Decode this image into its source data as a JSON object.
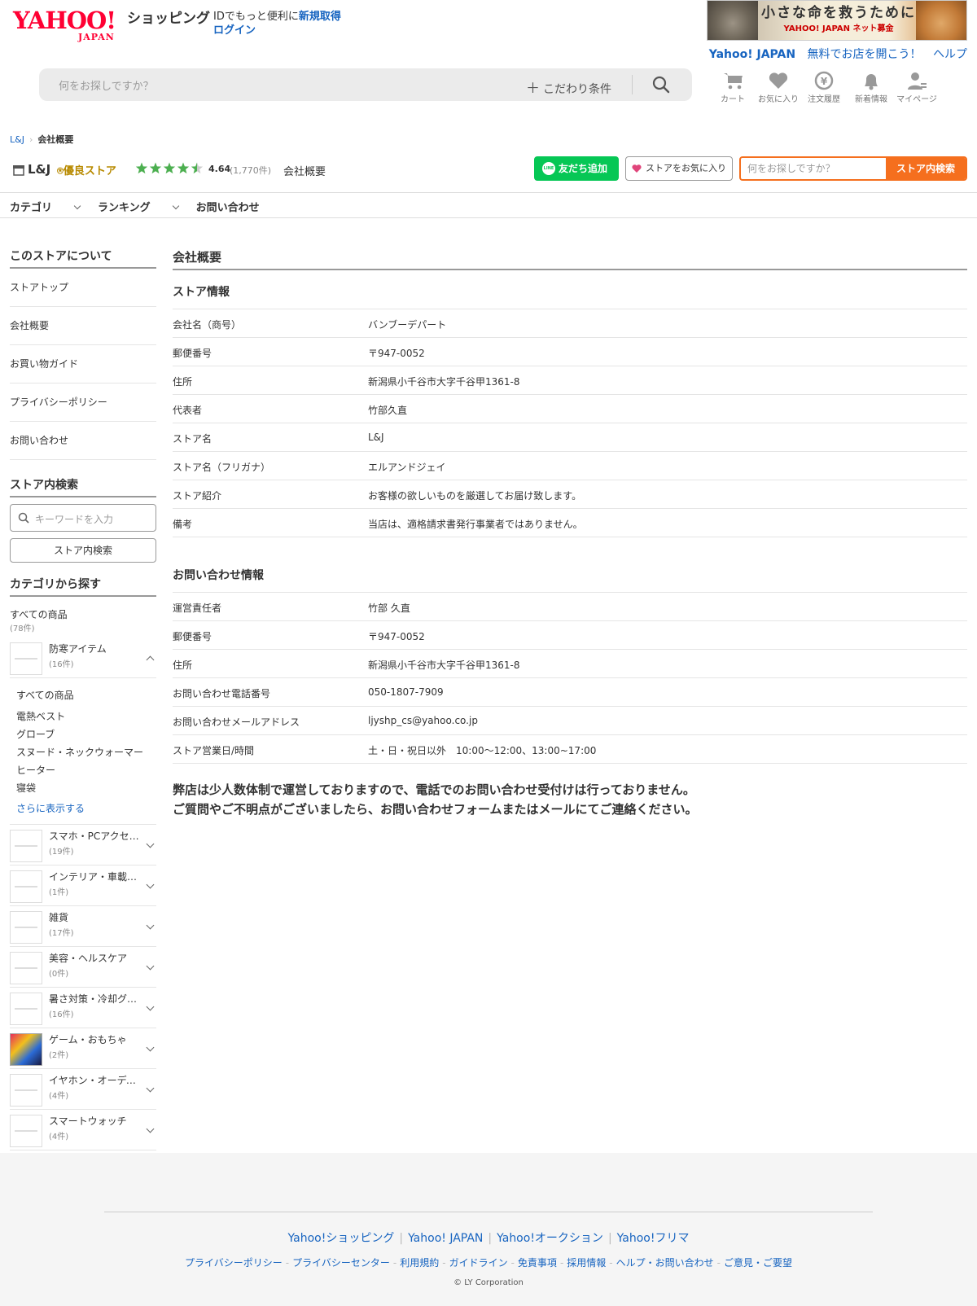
{
  "header": {
    "logo_main": "YAHOO!",
    "logo_sub": "JAPAN",
    "service_name": "ショッピング",
    "login_prompt": "IDでもっと便利に",
    "signup_link": "新規取得",
    "login_link": "ログイン",
    "banner_title": "小さな命を救うために",
    "banner_sub": "YAHOO! JAPAN ネット募金",
    "top_links": [
      "Yahoo! JAPAN",
      "無料でお店を開こう！",
      "ヘルプ"
    ],
    "search_placeholder": "何をお探しですか？",
    "search_condition": "こだわり条件",
    "icons": [
      {
        "label": "カート",
        "icon": "cart-icon"
      },
      {
        "label": "お気に入り",
        "icon": "heart-icon"
      },
      {
        "label": "注文履歴",
        "icon": "order-history-icon"
      },
      {
        "label": "新着情報",
        "icon": "bell-icon"
      },
      {
        "label": "マイページ",
        "icon": "user-icon"
      }
    ]
  },
  "breadcrumb": {
    "store": "L&J",
    "current": "会社概要"
  },
  "store": {
    "name": "L&J",
    "badge": "優良ストア",
    "rating": "4.64",
    "rating_value": 4.64,
    "review_count": "(1,770件)",
    "page_name": "会社概要",
    "line_button": "友だち追加",
    "favorite_button": "ストアをお気に入り",
    "search_placeholder": "何をお探しですか？",
    "search_button": "ストア内検索"
  },
  "global_nav": [
    "カテゴリ",
    "ランキング",
    "お問い合わせ"
  ],
  "sidebar": {
    "about_heading": "このストアについて",
    "about_links": [
      "ストアトップ",
      "会社概要",
      "お買い物ガイド",
      "プライバシーポリシー",
      "お問い合わせ"
    ],
    "search_heading": "ストア内検索",
    "search_placeholder": "キーワードを入力",
    "search_button": "ストア内検索",
    "category_heading": "カテゴリから探す",
    "all_items": {
      "label": "すべての商品",
      "count": "(78件)"
    },
    "expanded_category": {
      "name": "防寒アイテム",
      "count": "(16件)"
    },
    "sub_items": [
      "すべての商品",
      "電熱ベスト",
      "グローブ",
      "スヌード・ネックウォーマー",
      "ヒーター",
      "寝袋"
    ],
    "show_more": "さらに表示する",
    "categories": [
      {
        "name": "スマホ・PCアクセサリー",
        "count": "(19件)"
      },
      {
        "name": "インテリア・車載グッズ",
        "count": "(1件)"
      },
      {
        "name": "雑貨",
        "count": "(17件)"
      },
      {
        "name": "美容・ヘルスケア",
        "count": "(0件)"
      },
      {
        "name": "暑さ対策・冷却グッズ",
        "count": "(16件)"
      },
      {
        "name": "ゲーム・おもちゃ",
        "count": "(2件)"
      },
      {
        "name": "イヤホン・オーディオ",
        "count": "(4件)"
      },
      {
        "name": "スマートウォッチ",
        "count": "(4件)"
      }
    ]
  },
  "main": {
    "title": "会社概要",
    "store_info_heading": "ストア情報",
    "store_info": [
      {
        "label": "会社名（商号）",
        "value": "バンブーデパート"
      },
      {
        "label": "郵便番号",
        "value": "〒947-0052"
      },
      {
        "label": "住所",
        "value": "新潟県小千谷市大字千谷甲1361-8"
      },
      {
        "label": "代表者",
        "value": "竹部久直"
      },
      {
        "label": "ストア名",
        "value": "L&J"
      },
      {
        "label": "ストア名（フリガナ）",
        "value": "エルアンドジェイ"
      },
      {
        "label": "ストア紹介",
        "value": "お客様の欲しいものを厳選してお届け致します。"
      },
      {
        "label": "備考",
        "value": "当店は、適格請求書発行事業者ではありません。"
      }
    ],
    "contact_heading": "お問い合わせ情報",
    "contact_info": [
      {
        "label": "運営責任者",
        "value": "竹部 久直"
      },
      {
        "label": "郵便番号",
        "value": "〒947-0052"
      },
      {
        "label": "住所",
        "value": "新潟県小千谷市大字千谷甲1361-8"
      },
      {
        "label": "お問い合わせ電話番号",
        "value": "050-1807-7909"
      },
      {
        "label": "お問い合わせメールアドレス",
        "value": "ljyshp_cs@yahoo.co.jp"
      },
      {
        "label": "ストア営業日/時間",
        "value": "土・日・祝日以外　10:00〜12:00、13:00~17:00"
      }
    ],
    "notice_line1": "弊店は少人数体制で運営しておりますので、電話でのお問い合わせ受付けは行っておりません。",
    "notice_line2": "ご質問やご不明点がございましたら、お問い合わせフォームまたはメールにてご連絡ください。"
  },
  "footer": {
    "links_primary": [
      "Yahoo!ショッピング",
      "Yahoo! JAPAN",
      "Yahoo!オークション",
      "Yahoo!フリマ"
    ],
    "links_secondary": [
      "プライバシーポリシー",
      "プライバシーセンター",
      "利用規約",
      "ガイドライン",
      "免責事項",
      "採用情報",
      "ヘルプ・お問い合わせ",
      "ご意見・ご要望"
    ],
    "copyright": "© LY Corporation"
  },
  "colors": {
    "link": "#1764c0",
    "brand_red": "#ff0033",
    "store_search_orange": "#f56f1e",
    "line_green": "#06c755",
    "star_green": "#4caf50"
  }
}
